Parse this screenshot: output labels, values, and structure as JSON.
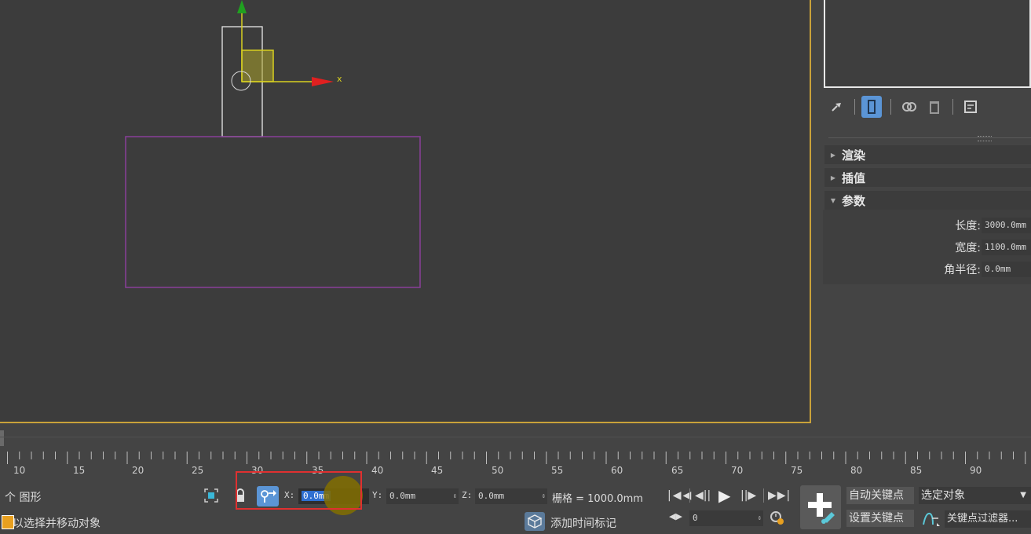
{
  "gizmo": {
    "x_axis_label": "x"
  },
  "command_panel": {
    "toolbar_icons": [
      "pin-icon",
      "modifier-stack-icon",
      "make-unique-icon",
      "delete-icon",
      "configure-icon"
    ],
    "rollouts": [
      {
        "label": "渲染",
        "expanded": false
      },
      {
        "label": "插值",
        "expanded": false
      },
      {
        "label": "参数",
        "expanded": true
      }
    ],
    "params": {
      "length_label": "长度:",
      "length_value": "3000.0mm",
      "width_label": "宽度:",
      "width_value": "1100.0mm",
      "corner_radius_label": "角半径:",
      "corner_radius_value": "0.0mm"
    }
  },
  "timeline": {
    "ticks": [
      "10",
      "15",
      "20",
      "25",
      "30",
      "35",
      "40",
      "45",
      "50",
      "55",
      "60",
      "65",
      "70",
      "75",
      "80",
      "85",
      "90"
    ]
  },
  "status": {
    "selection_text": "个 图形",
    "prompt_text": "以选择并移动对象",
    "x_label": "X:",
    "x_value": "0.0mm",
    "y_label": "Y:",
    "y_value": "0.0mm",
    "z_label": "Z:",
    "z_value": "0.0mm",
    "grid_text": "栅格 = 1000.0mm",
    "add_time_tag": "添加时间标记"
  },
  "anim": {
    "frame_value": "0",
    "auto_key": "自动关键点",
    "set_key": "设置关键点",
    "selected_dropdown": "选定对象",
    "key_filters": "关键点过滤器..."
  },
  "colors": {
    "viewport_border": "#c9a23a",
    "rectangle_shape": "#8a3f9a",
    "gizmo_x": "#e02020",
    "gizmo_y": "#20a020",
    "gizmo_plane": "#c8c020",
    "highlight_box": "#e03030",
    "active_button": "#5b95d6"
  }
}
